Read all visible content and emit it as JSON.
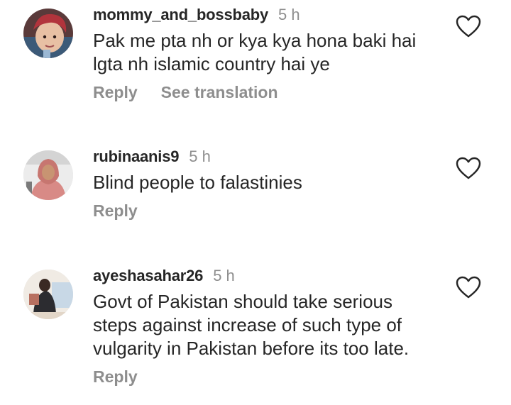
{
  "comments": [
    {
      "username": "mommy_and_bossbaby",
      "time": "5 h",
      "lines": [
        "Pak me pta nh or kya kya hona baki hai",
        "lgta nh islamic country hai ye"
      ],
      "reply_label": "Reply",
      "translate_label": "See translation"
    },
    {
      "username": "rubinaanis9",
      "time": "5 h",
      "lines": [
        "Blind people to falastinies"
      ],
      "reply_label": "Reply"
    },
    {
      "username": "ayeshasahar26",
      "time": "5 h",
      "lines": [
        "Govt of Pakistan should take serious",
        "steps against increase of such type of",
        "vulgarity in Pakistan before its too late."
      ],
      "reply_label": "Reply"
    }
  ],
  "icons": {
    "like": "heart-outline-icon",
    "avatar": "profile-picture"
  },
  "colors": {
    "text": "#262626",
    "secondary": "#8e8e8e",
    "background": "#ffffff"
  }
}
